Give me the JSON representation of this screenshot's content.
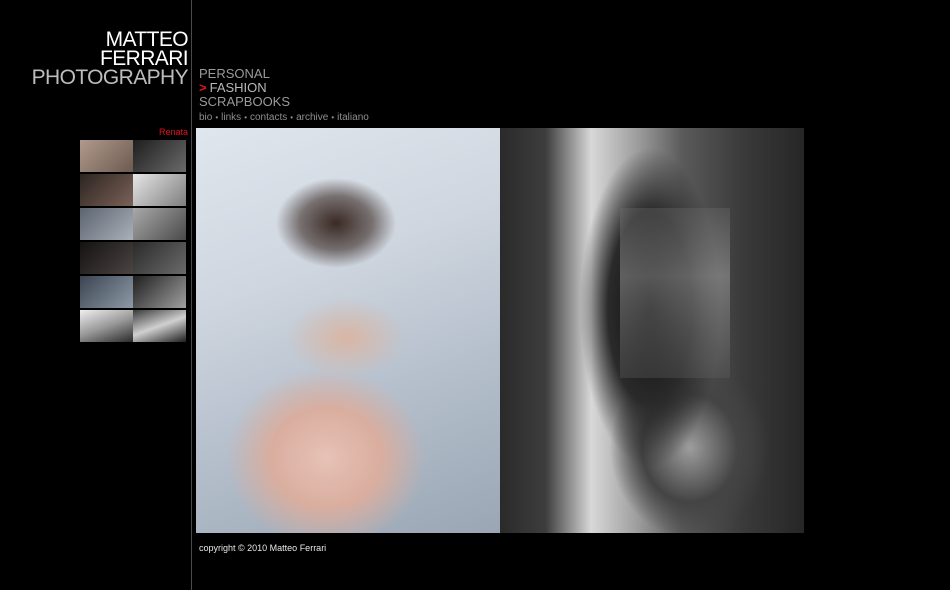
{
  "logo": {
    "line1": "MATTEO",
    "line2": "FERRARI",
    "line3": "PHOTOGRAPHY"
  },
  "nav": {
    "items": [
      {
        "label": "PERSONAL",
        "active": false
      },
      {
        "label": "FASHION",
        "active": true,
        "marker": ">"
      },
      {
        "label": "SCRAPBOOKS",
        "active": false
      }
    ]
  },
  "subnav": {
    "separator": "•",
    "links": [
      "bio",
      "links",
      "contacts",
      "archive",
      "italiano"
    ]
  },
  "album": {
    "title": "Renata"
  },
  "thumbnails": [
    {
      "left": "#8a7a70",
      "right": "#3a3a3a"
    },
    {
      "left": "#4a3a34",
      "right": "#bdbdbd"
    },
    {
      "left": "#7a7f88",
      "right": "#8d8d8d"
    },
    {
      "left": "#22201f",
      "right": "#3a3a3a"
    },
    {
      "left": "#56606e",
      "right": "#7a7a7a"
    },
    {
      "left": "#dcdcdc",
      "right": "#2a2a2a"
    }
  ],
  "photos": [
    {
      "name": "photo-left",
      "description_icon": "photo-icon"
    },
    {
      "name": "photo-right",
      "description_icon": "photo-icon"
    }
  ],
  "footer": {
    "copyright": "copyright © 2010 Matteo Ferrari"
  },
  "colors": {
    "accent": "#e4101a",
    "background": "#000000",
    "nav_text": "#9a9a9a"
  }
}
